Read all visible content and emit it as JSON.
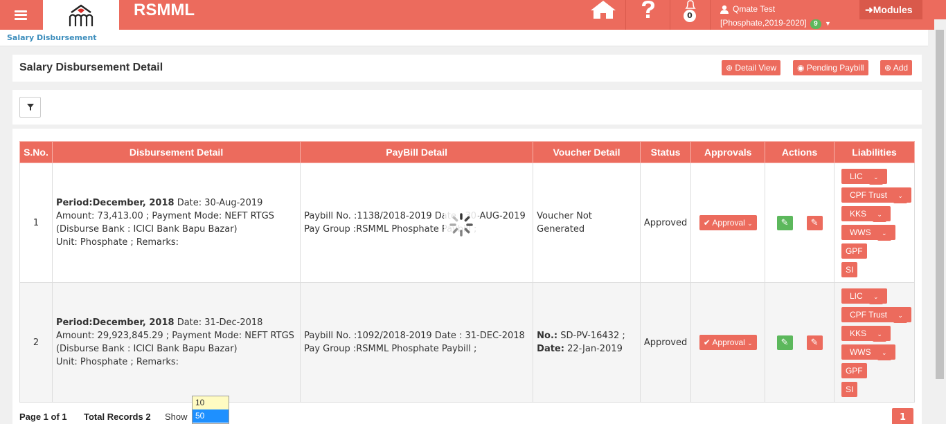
{
  "header": {
    "brand": "RSMML",
    "notification_count": "0",
    "user_name": "Qmate Test",
    "user_context": "[Phosphate,2019-2020]",
    "user_badge": "9",
    "modules_label": "Modules"
  },
  "breadcrumb": "Salary Disbursement",
  "panel": {
    "title": "Salary Disbursement Detail",
    "detail_view": "Detail View",
    "pending_paybill": "Pending Paybill",
    "add": "Add"
  },
  "table": {
    "headers": [
      "S.No.",
      "Disbursement Detail",
      "PayBill Detail",
      "Voucher Detail",
      "Status",
      "Approvals",
      "Actions",
      "Liabilities"
    ],
    "rows": [
      {
        "sno": "1",
        "period_label": "Period:",
        "period": "December, 2018",
        "date": " Date: 30-Aug-2019",
        "amount": "Amount: 73,413.00 ; Payment Mode: NEFT RTGS",
        "bank": "(Disburse Bank : ICICI Bank Bapu Bazar)",
        "unit": "Unit: Phosphate ; Remarks:",
        "paybill": "Paybill No. :1138/2018-2019 Date : 30-AUG-2019 Pay Group :RSMML Phosphate Paybill ;",
        "voucher": "Voucher Not Generated",
        "status": "Approved",
        "approval": "Approval"
      },
      {
        "sno": "2",
        "period_label": "Period:",
        "period": "December, 2018",
        "date": " Date: 31-Dec-2018",
        "amount": "Amount: 29,923,845.29 ; Payment Mode: NEFT RTGS",
        "bank": "(Disburse Bank : ICICI Bank Bapu Bazar)",
        "unit": "Unit: Phosphate ; Remarks:",
        "paybill": "Paybill No. :1092/2018-2019 Date : 31-DEC-2018 Pay Group :RSMML Phosphate Paybill ;",
        "voucher_no_label": "No.:",
        "voucher_no": " SD-PV-16432 ;",
        "voucher_date_label": "Date:",
        "voucher_date": " 22-Jan-2019",
        "status": "Approved",
        "approval": "Approval"
      }
    ],
    "liabilities": [
      "LIC",
      "CPF Trust",
      "KKS",
      "WWS",
      "GPF",
      "SI"
    ]
  },
  "footer": {
    "page_info": "Page 1 of 1",
    "total_records": "Total Records 2",
    "show_label": "Show",
    "page_size_options": [
      "10",
      "50"
    ],
    "selected_page_size": "50",
    "current_page": "1"
  },
  "colors": {
    "accent": "#ec6b5d",
    "success": "#5cb85c",
    "link": "#3c8dbc"
  }
}
